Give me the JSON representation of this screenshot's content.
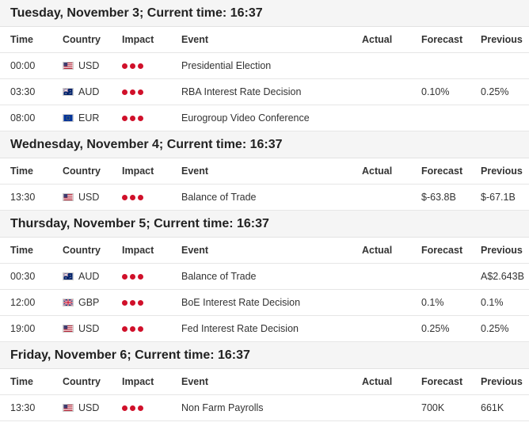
{
  "columns": [
    "Time",
    "Country",
    "Impact",
    "Event",
    "Actual",
    "Forecast",
    "Previous"
  ],
  "colors": {
    "impact_high": "#d0102a",
    "header_bg": "#f5f5f5"
  },
  "days": [
    {
      "title": "Tuesday, November 3; Current time: 16:37",
      "events": [
        {
          "time": "00:00",
          "country": "USD",
          "flag": "us-flag-icon",
          "event": "Presidential Election",
          "actual": "",
          "forecast": "",
          "previous": ""
        },
        {
          "time": "03:30",
          "country": "AUD",
          "flag": "au-flag-icon",
          "event": "RBA Interest Rate Decision",
          "actual": "",
          "forecast": "0.10%",
          "previous": "0.25%"
        },
        {
          "time": "08:00",
          "country": "EUR",
          "flag": "eu-flag-icon",
          "event": "Eurogroup Video Conference",
          "actual": "",
          "forecast": "",
          "previous": ""
        }
      ]
    },
    {
      "title": "Wednesday, November 4; Current time: 16:37",
      "events": [
        {
          "time": "13:30",
          "country": "USD",
          "flag": "us-flag-icon",
          "event": "Balance of Trade",
          "actual": "",
          "forecast": "$-63.8B",
          "previous": "$-67.1B"
        }
      ]
    },
    {
      "title": "Thursday, November 5; Current time: 16:37",
      "events": [
        {
          "time": "00:30",
          "country": "AUD",
          "flag": "au-flag-icon",
          "event": "Balance of Trade",
          "actual": "",
          "forecast": "",
          "previous": "A$2.643B"
        },
        {
          "time": "12:00",
          "country": "GBP",
          "flag": "gb-flag-icon",
          "event": "BoE Interest Rate Decision",
          "actual": "",
          "forecast": "0.1%",
          "previous": "0.1%"
        },
        {
          "time": "19:00",
          "country": "USD",
          "flag": "us-flag-icon",
          "event": "Fed Interest Rate Decision",
          "actual": "",
          "forecast": "0.25%",
          "previous": "0.25%"
        }
      ]
    },
    {
      "title": "Friday, November 6; Current time: 16:37",
      "events": [
        {
          "time": "13:30",
          "country": "USD",
          "flag": "us-flag-icon",
          "event": "Non Farm Payrolls",
          "actual": "",
          "forecast": "700K",
          "previous": "661K"
        }
      ]
    }
  ]
}
